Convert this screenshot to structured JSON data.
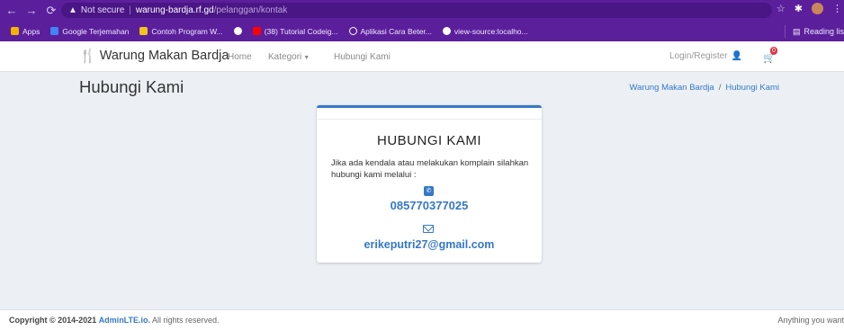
{
  "browser": {
    "security": "Not secure",
    "host": "warung-bardja.rf.gd",
    "path": "/pelanggan/kontak",
    "bookmarks": [
      {
        "label": "Apps",
        "color": "#f4b400"
      },
      {
        "label": "Google Terjemahan",
        "color": "#4285f4"
      },
      {
        "label": "Contoh Program W...",
        "color": "#f0c419"
      },
      {
        "label": "",
        "color": "#ffffff"
      },
      {
        "label": "(38) Tutorial Codeig...",
        "color": "#ff0000"
      },
      {
        "label": "Aplikasi Cara Beter...",
        "color": "#ffffff"
      },
      {
        "label": "view-source:localho...",
        "color": "#ffffff"
      }
    ],
    "reading_list": "Reading lis"
  },
  "navbar": {
    "brand": "Warung Makan Bardja",
    "home": "Home",
    "kategori": "Kategori",
    "hubungi": "Hubungi Kami",
    "login": "Login/Register",
    "cart_count": "0"
  },
  "header": {
    "title": "Hubungi Kami",
    "breadcrumb": [
      "Warung Makan Bardja",
      "/",
      "Hubungi Kami"
    ]
  },
  "card": {
    "title": "HUBUNGI KAMI",
    "text": "Jika ada kendala atau melakukan komplain silahkan hubungi kami melalui :",
    "phone": "085770377025",
    "email": "erikeputri27@gmail.com"
  },
  "footer": {
    "copy_prefix": "Copyright © 2014-2021",
    "copy_link": "AdminLTE.io.",
    "copy_suffix": "All rights reserved.",
    "right": "Anything you want"
  },
  "colors": {
    "chrome": "#5b1f9c",
    "accent": "#3578c7"
  }
}
